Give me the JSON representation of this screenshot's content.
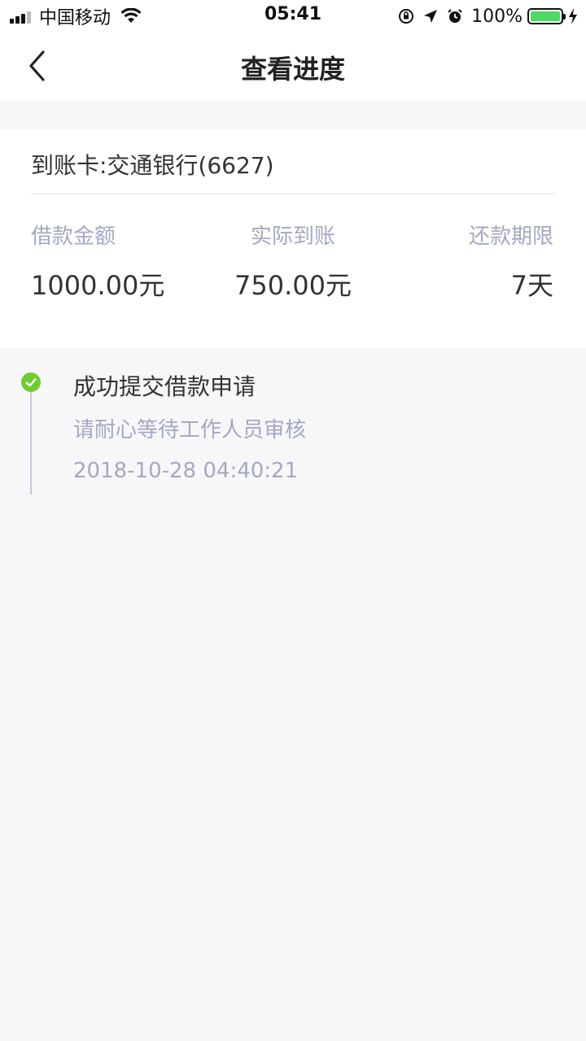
{
  "status_bar": {
    "carrier": "中国移动",
    "time": "05:41",
    "battery_percent": "100%",
    "icons": [
      "signal-icon",
      "wifi-icon",
      "rotation-lock-icon",
      "location-icon",
      "alarm-icon",
      "battery-icon",
      "charging-icon"
    ]
  },
  "nav": {
    "title": "查看进度",
    "back_icon": "chevron-left-icon"
  },
  "card": {
    "account": "到账卡:交通银行(6627)",
    "stats": [
      {
        "label": "借款金额",
        "value": "1000.00元"
      },
      {
        "label": "实际到账",
        "value": "750.00元"
      },
      {
        "label": "还款期限",
        "value": "7天"
      }
    ]
  },
  "timeline": {
    "steps": [
      {
        "title": "成功提交借款申请",
        "description": "请耐心等待工作人员审核",
        "time": "2018-10-28 04:40:21",
        "status_color": "#6fcc2e"
      }
    ]
  },
  "colors": {
    "accent_green": "#6fcc2e",
    "muted_text": "#a4a8c2",
    "background": "#f7f7fa"
  }
}
